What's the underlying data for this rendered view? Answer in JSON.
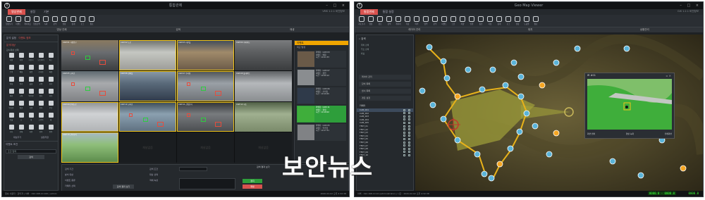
{
  "w1": {
    "app_title": "통합관제",
    "tabs": [
      "영상관제",
      "설정",
      "기본"
    ],
    "version": "VMS 1.2.1 버전정보",
    "toolbar": [
      {
        "label": "영상보기",
        "icon": "monitor-icon"
      },
      {
        "label": "이벤트",
        "icon": "alarm-icon"
      },
      {
        "label": "레이아웃",
        "icon": "layout-icon"
      },
      {
        "label": "영상검색",
        "icon": "search-icon"
      },
      {
        "label": "녹화",
        "icon": "record-icon"
      },
      {
        "label": "분석",
        "icon": "analysis-icon"
      },
      {
        "label": "설정",
        "icon": "gear-icon"
      },
      {
        "label": "통계",
        "icon": "chart-icon"
      },
      {
        "label": "로그",
        "icon": "log-icon"
      },
      {
        "label": "종료",
        "icon": "exit-icon"
      }
    ],
    "subtabs": [
      "영상 관제",
      "검색",
      "재생"
    ],
    "left_panel": {
      "tabs": [
        "분석 설정",
        "이벤트 정보"
      ],
      "section": "분석대상",
      "sub": "감시대상 선택",
      "icons": [
        "사람",
        "차량",
        "자전거",
        "오토바이",
        "버스",
        "트럭",
        "배회",
        "침입",
        "쓰러짐",
        "싸움",
        "방화",
        "연기",
        "불꽃",
        "군중",
        "유기",
        "제거",
        "교통",
        "역주행",
        "정지",
        "과속",
        "번호판",
        "얼굴",
        "가방",
        "모자",
        "우산",
        "동물",
        "소",
        "개",
        "고양이",
        "새",
        "기타",
        "전체",
        "라인",
        "영역",
        "방향"
      ],
      "bottom_labels": [
        "대상추가",
        "설정저장"
      ],
      "section2": "이벤트 조건",
      "field_placeholder": "조건 입력",
      "button": "검색"
    },
    "cells": [
      "CAM 01 시장입구",
      "CAM 02 도로",
      "CAM 03 사무실",
      "CAM 04 지하차도",
      "CAM 05 교차로",
      "CAM 06 상황실",
      "CAM 07 주차장",
      "CAM 08 톨게이트",
      "CAM 09 안개도로",
      "CAM 10 교차로",
      "CAM 11 산업단지",
      "CAM 12 국도",
      "CAM 13 산악지역",
      "채널없음",
      "채널없음",
      "채널없음"
    ],
    "event_list": {
      "title": "이벤트",
      "subtitle": "최근 발생",
      "items": [
        {
          "lines": [
            "카메라 : CAM 03",
            "이벤트 : 배회",
            "시간 : 10:21:33"
          ]
        },
        {
          "lines": [
            "카메라 : CAM 07",
            "이벤트 : 침입",
            "시간 : 10:20:12"
          ]
        },
        {
          "lines": [
            "카메라 : CAM 06",
            "이벤트 : 쓰러짐",
            "시간 : 10:19:45"
          ]
        },
        {
          "lines": [
            "카메라 : CAM 11",
            "이벤트 : 화재",
            "시간 : 10:18:02"
          ]
        },
        {
          "lines": [
            "카메라 : CAM 05",
            "이벤트 : 역주행",
            "시간 : 10:17:31"
          ]
        }
      ]
    },
    "bottom": {
      "labels_left": [
        "검색 기간",
        "분석 대상",
        "이벤트 종류",
        "카메라 선택"
      ],
      "labels_mid": [
        "검색 조건",
        "대상 선택",
        "객체 속성",
        "저장 기능"
      ],
      "button_left": "검색 결과 보기",
      "button_mid1": "정지",
      "button_mid2": "재생",
      "status_title": "검색 결과 보기"
    },
    "status_left": "접속 사용자 : 관리자 | 서버 : 192.168.10.100 | admin",
    "status_right": "2020-02-02 오후 4:32:38"
  },
  "w2": {
    "app_title": "Geo Map Viewer",
    "tabs": [
      "통합관제",
      "통합 설정"
    ],
    "version": "GIS 1.2.1 버전정보",
    "toolbar": [
      {
        "label": "지도보기",
        "icon": "map-icon"
      },
      {
        "label": "영상",
        "icon": "camera-icon"
      },
      {
        "label": "경로",
        "icon": "route-icon"
      },
      {
        "label": "검색",
        "icon": "search-icon"
      },
      {
        "label": "레이어",
        "icon": "layer-icon"
      },
      {
        "label": "측정",
        "icon": "ruler-icon"
      },
      {
        "label": "마커",
        "icon": "marker-icon"
      },
      {
        "label": "영역",
        "icon": "area-icon"
      },
      {
        "label": "분석",
        "icon": "analysis-icon"
      },
      {
        "label": "이벤트",
        "icon": "alarm-icon"
      },
      {
        "label": "드론",
        "icon": "drone-icon"
      },
      {
        "label": "차량",
        "icon": "vehicle-icon"
      },
      {
        "label": "인원",
        "icon": "person-icon"
      },
      {
        "label": "통신",
        "icon": "radio-icon"
      },
      {
        "label": "기상",
        "icon": "weather-icon"
      },
      {
        "label": "통계",
        "icon": "chart-icon"
      },
      {
        "label": "로그",
        "icon": "log-icon"
      },
      {
        "label": "설정",
        "icon": "gear-icon"
      },
      {
        "label": "도움말",
        "icon": "help-icon"
      },
      {
        "label": "종료",
        "icon": "exit-icon"
      }
    ],
    "subtabs": [
      "레이어 관리",
      "위치",
      "상황관리"
    ],
    "left_panel": {
      "search_label": "검색",
      "search_rows": [
        "위치 검색",
        "주소 검색",
        "좌표"
      ],
      "blocks": [
        "레이어 관리",
        "장비 목록",
        "센서 목록",
        "경로 설정"
      ],
      "list_title": "카메라",
      "rows": [
        "CAM_001",
        "CAM_002",
        "CAM_003",
        "CAM_004",
        "CAM_005",
        "TEST_01",
        "TEST_02",
        "TEST_03",
        "TEST_04",
        "TEST_05",
        "TEST_06",
        "TEST_07",
        "TEST_08",
        "TEST_09",
        "TEST_10"
      ]
    },
    "pip": {
      "title": "IR #01",
      "buttons": [
        "화면 캡처",
        "영상 녹화",
        "전체화면"
      ]
    },
    "indicators": [
      "0000.0 · 0000.0",
      "0000.0"
    ],
    "status_left": "서버 : 192.168.10.10 (administrator) | 시간 : 2020-02-02 오후 4:32:38"
  },
  "watermark": "보안뉴스"
}
